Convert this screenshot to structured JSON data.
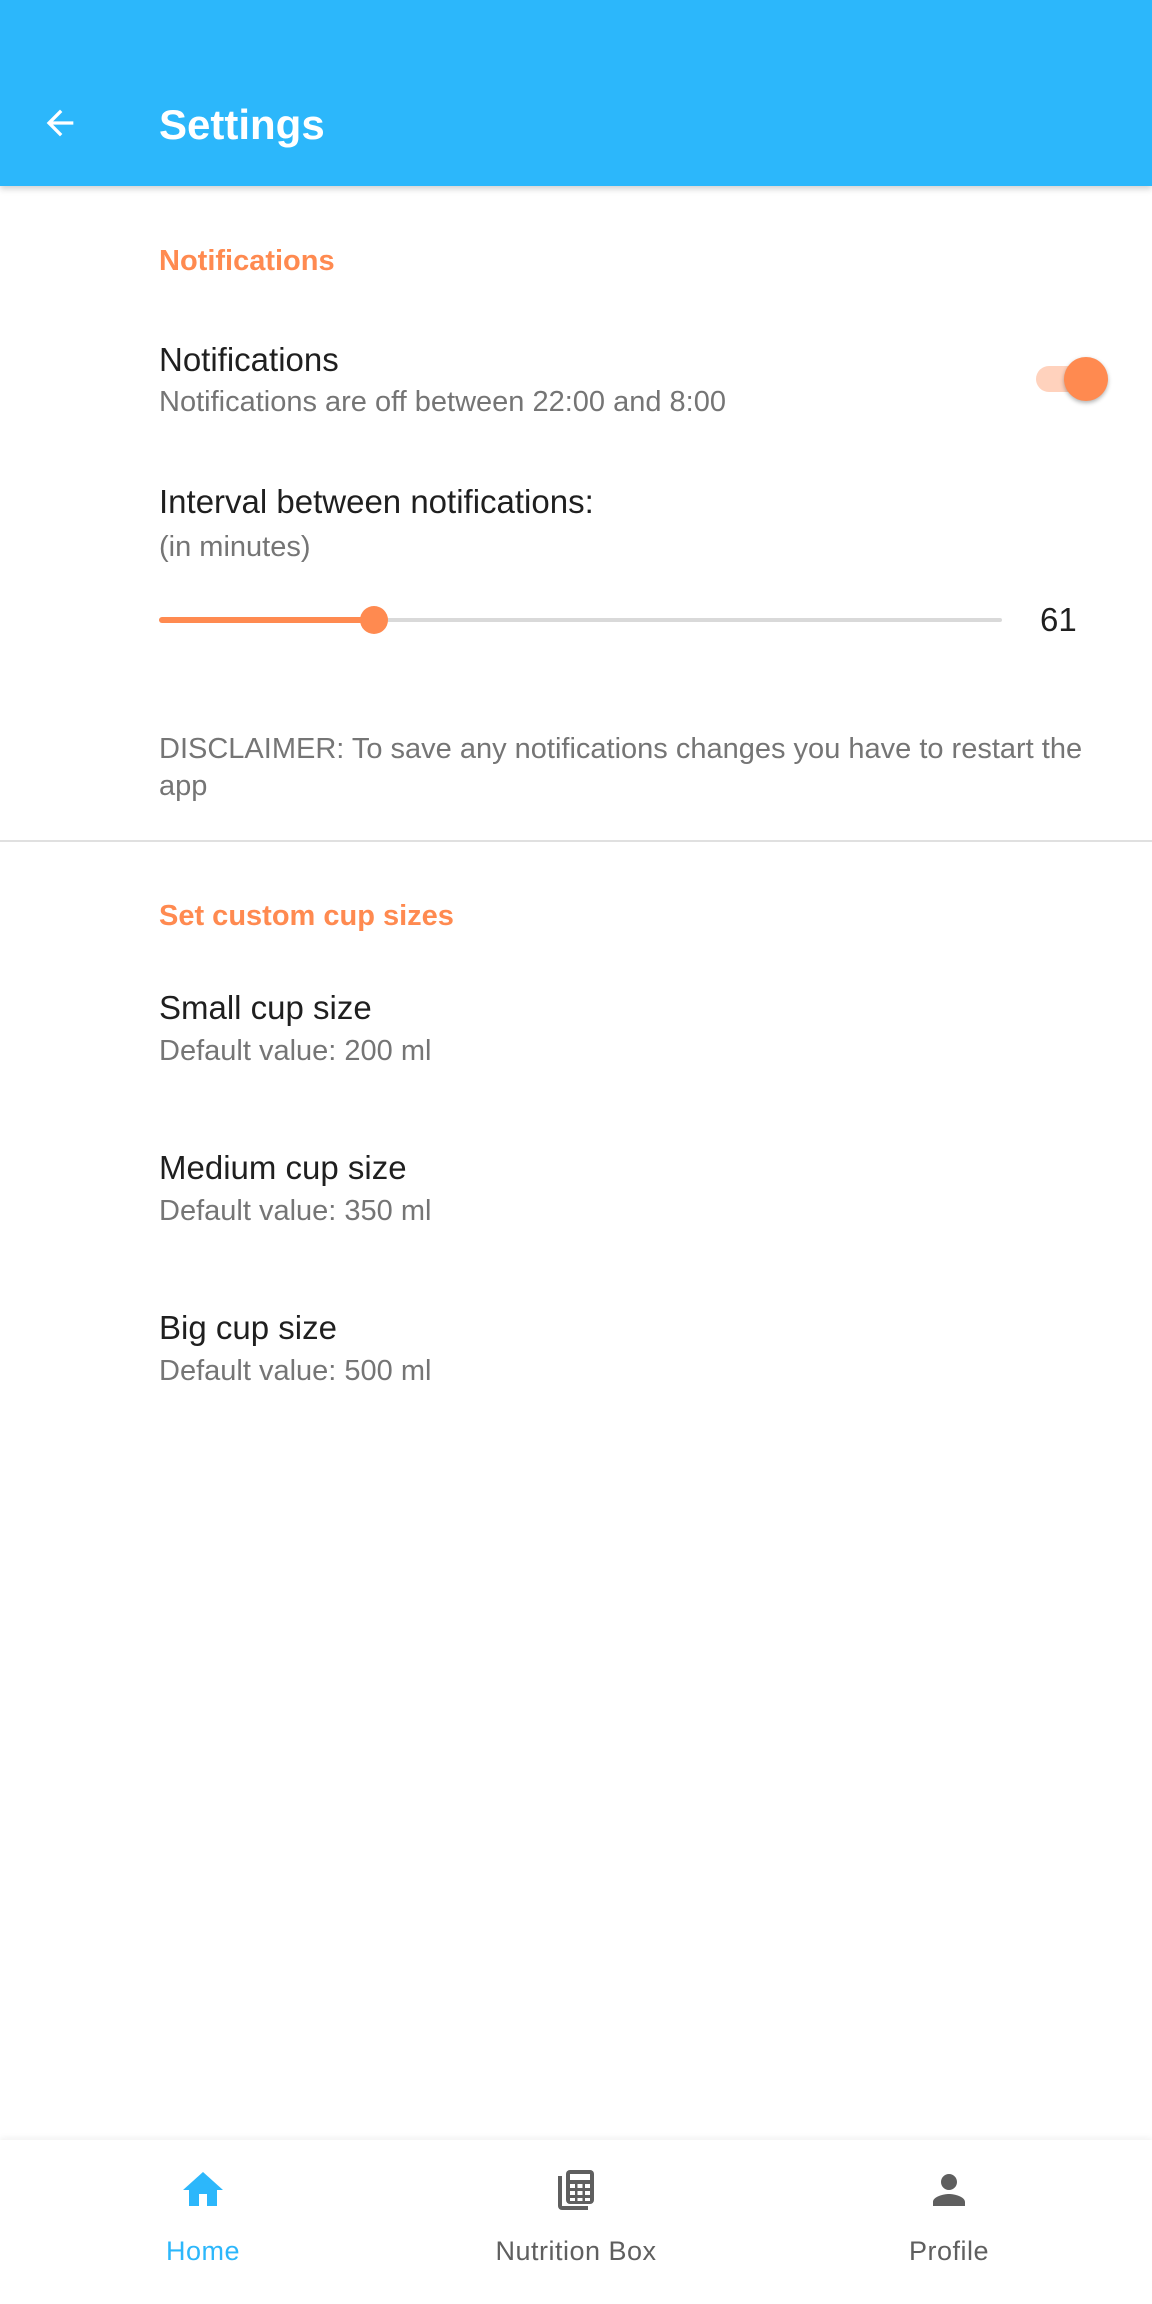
{
  "app_bar": {
    "title": "Settings",
    "back_icon": "arrow-back-icon",
    "color": "#2cb7fb"
  },
  "accent_color": "#ff8a50",
  "notifications_section": {
    "header": "Notifications",
    "toggle_pref": {
      "title": "Notifications",
      "summary": "Notifications are off between 22:00 and 8:00",
      "enabled": true
    },
    "interval_pref": {
      "title": "Interval between notifications:",
      "summary": "(in minutes)",
      "value": "61",
      "value_fraction": 0.255
    },
    "disclaimer": "DISCLAIMER: To save any notifications changes you have to restart the app"
  },
  "cup_sizes_section": {
    "header": "Set custom cup sizes",
    "items": [
      {
        "title": "Small cup size",
        "summary": "Default value: 200 ml"
      },
      {
        "title": "Medium cup size",
        "summary": "Default value: 350 ml"
      },
      {
        "title": "Big cup size",
        "summary": "Default value: 500 ml"
      }
    ]
  },
  "bottom_nav": {
    "items": [
      {
        "label": "Home",
        "icon": "home-icon",
        "active": true
      },
      {
        "label": "Nutrition Box",
        "icon": "calculator-icon",
        "active": false
      },
      {
        "label": "Profile",
        "icon": "person-icon",
        "active": false
      }
    ],
    "active_color": "#2cb7fb",
    "inactive_color": "#5f5f5f"
  }
}
